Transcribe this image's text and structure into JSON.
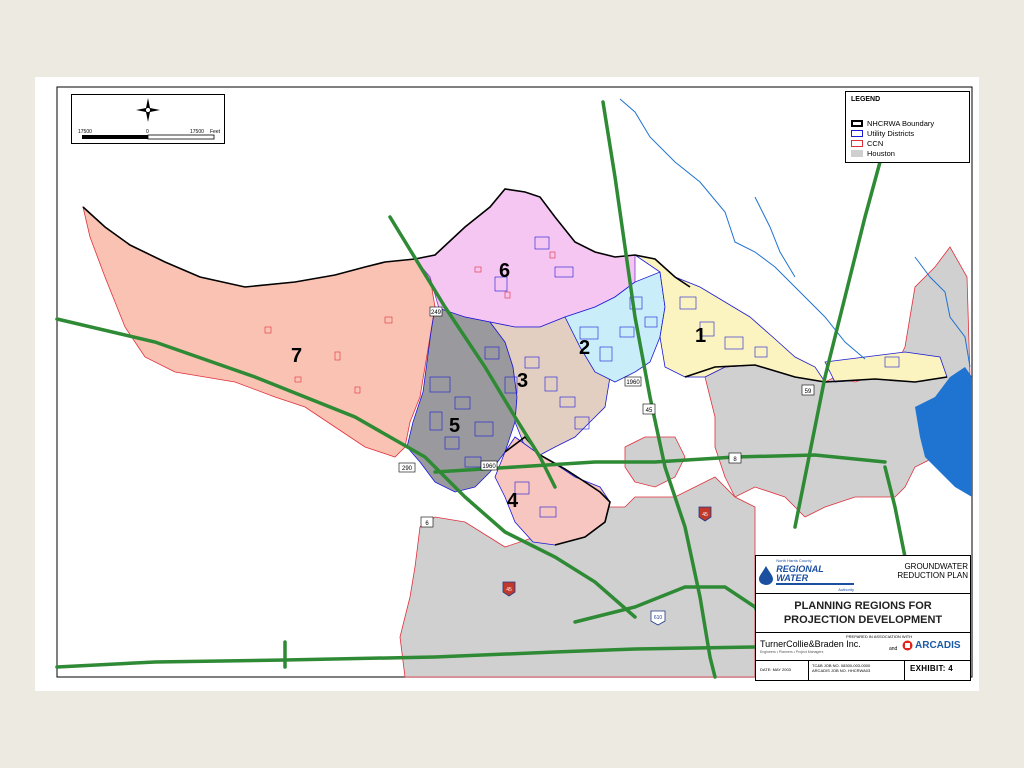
{
  "map": {
    "regions": [
      {
        "label": "1",
        "fill": "#fbf3c0"
      },
      {
        "label": "2",
        "fill": "#c9eefa"
      },
      {
        "label": "3",
        "fill": "#e3cfc2"
      },
      {
        "label": "4",
        "fill": "#f7c6c0"
      },
      {
        "label": "5",
        "fill": "#9a9a9e"
      },
      {
        "label": "6",
        "fill": "#f6c6f3"
      },
      {
        "label": "7",
        "fill": "#f9c2b3"
      }
    ],
    "houston_fill": "#d0d0d0",
    "highway_color": "#2e8a34",
    "water_color": "#1f73d1",
    "shields": [
      "290",
      "1960",
      "1960",
      "6",
      "45",
      "8",
      "59",
      "249"
    ],
    "interstate_shields": [
      "45",
      "45",
      "610"
    ]
  },
  "scale_bar": {
    "left_label": "17500",
    "mid_label": "0",
    "right_label": "17500",
    "unit": "Feet"
  },
  "legend": {
    "title": "LEGEND",
    "items": [
      {
        "label": "NHCRWA Boundary",
        "color": "#000000"
      },
      {
        "label": "Utility Districts",
        "color": "#1a1ad6"
      },
      {
        "label": "CCN",
        "color": "#e0303c"
      },
      {
        "label": "Houston",
        "color": "#cfcfcf"
      }
    ]
  },
  "title_block": {
    "logo_top": "North Harris County",
    "logo_main": "REGIONAL WATER",
    "logo_bottom": "Authority",
    "gw_line1": "GROUNDWATER",
    "gw_line2": "REDUCTION PLAN",
    "title_line1": "PLANNING REGIONS FOR",
    "title_line2": "PROJECTION DEVELOPMENT",
    "prepared_by": "PREPARED IN ASSOCIATION WITH",
    "firm1": "TurnerCollie&Braden Inc.",
    "firm1_sub": "Engineers • Planners • Project Managers",
    "and": "and",
    "firm2": "ARCADIS",
    "date": "DATE: MAY 2003",
    "job1": "TC&B JOB NO. 08300-003-0000",
    "job2": "ARCADIS JOB NO. HHCRWA03",
    "exhibit": "EXHIBIT: 4"
  }
}
